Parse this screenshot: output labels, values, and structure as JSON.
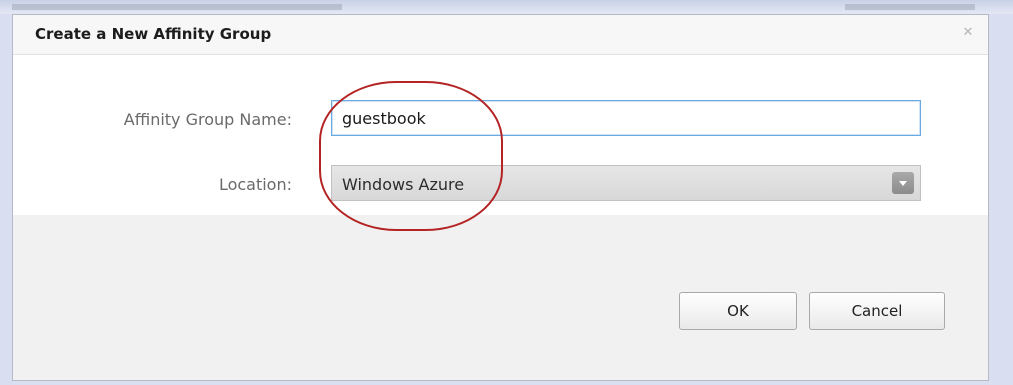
{
  "dialog": {
    "title": "Create a New Affinity Group",
    "close_icon": "close-icon",
    "fields": {
      "name_label": "Affinity Group Name:",
      "name_value": "guestbook",
      "location_label": "Location:",
      "location_value": "Windows Azure",
      "location_dropdown_icon": "chevron-down-icon"
    },
    "buttons": {
      "ok": "OK",
      "cancel": "Cancel"
    },
    "annotation": {
      "shape": "ellipse",
      "color": "#b52424"
    }
  },
  "colors": {
    "input_focus_border": "#6aa8e0",
    "backdrop": "#d9dff0"
  }
}
